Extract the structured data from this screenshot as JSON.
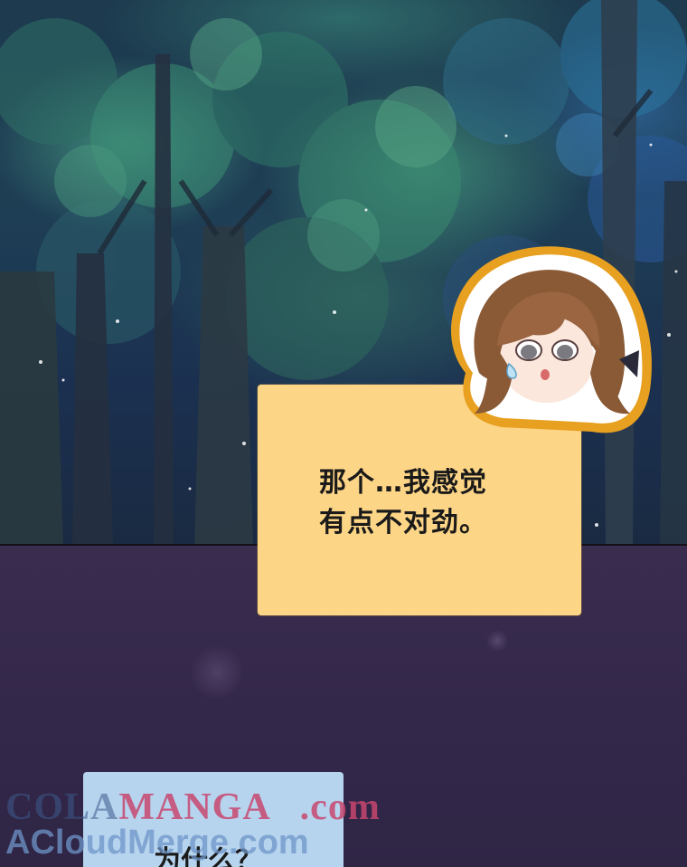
{
  "panels": {
    "speech": {
      "lines": [
        "那个…我感觉",
        "有点不对劲。"
      ],
      "color": "#fdd586"
    },
    "reply": {
      "text": "为什么？",
      "color": "#b6d4ee"
    }
  },
  "watermark": {
    "brand_part1": "COLA",
    "brand_part2": "MANGA",
    "tld": ".com",
    "line2": "ACloudMerge.com"
  },
  "colors": {
    "forest_dark": "#1d3a4e",
    "night_purple": "#34284a",
    "portrait_outline": "#e8a020"
  }
}
